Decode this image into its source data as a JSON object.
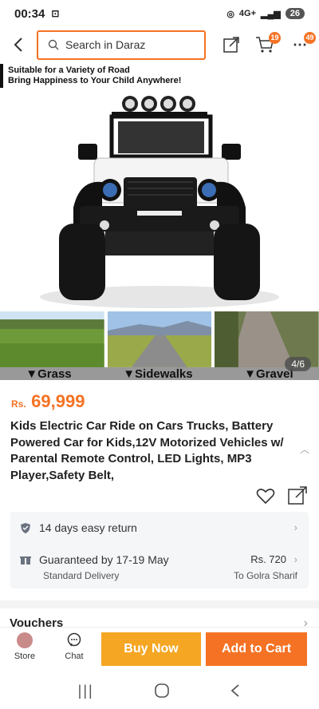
{
  "status": {
    "time": "00:34",
    "network": "4G+",
    "battery": "26"
  },
  "header": {
    "search_placeholder": "Search in Daraz",
    "cart_count": "19",
    "more_count": "49"
  },
  "banner": {
    "line1": "Suitable for a Variety of Road",
    "line2": "Bring Happiness to Your Child Anywhere!"
  },
  "gallery": {
    "thumb_labels": [
      "▼Grass",
      "▼Sidewalks",
      "▼Gravel"
    ],
    "counter": "4/6"
  },
  "product": {
    "currency": "Rs.",
    "price": "69,999",
    "title": "Kids Electric Car Ride on Cars Trucks, Battery Powered Car for Kids,12V Motorized Vehicles w/ Parental Remote Control, LED Lights, MP3 Player,Safety Belt,"
  },
  "service": {
    "return_label": "14 days easy return",
    "guarantee_label": "Guaranteed by 17-19 May",
    "delivery_type": "Standard Delivery",
    "delivery_fee": "Rs. 720",
    "delivery_to": "To Golra Sharif"
  },
  "vouchers": {
    "label": "Vouchers"
  },
  "bottom": {
    "store": "Store",
    "chat": "Chat",
    "buy_now": "Buy Now",
    "add_to_cart": "Add to Cart"
  },
  "colors": {
    "accent": "#f57224",
    "buy_now": "#f5a623"
  }
}
